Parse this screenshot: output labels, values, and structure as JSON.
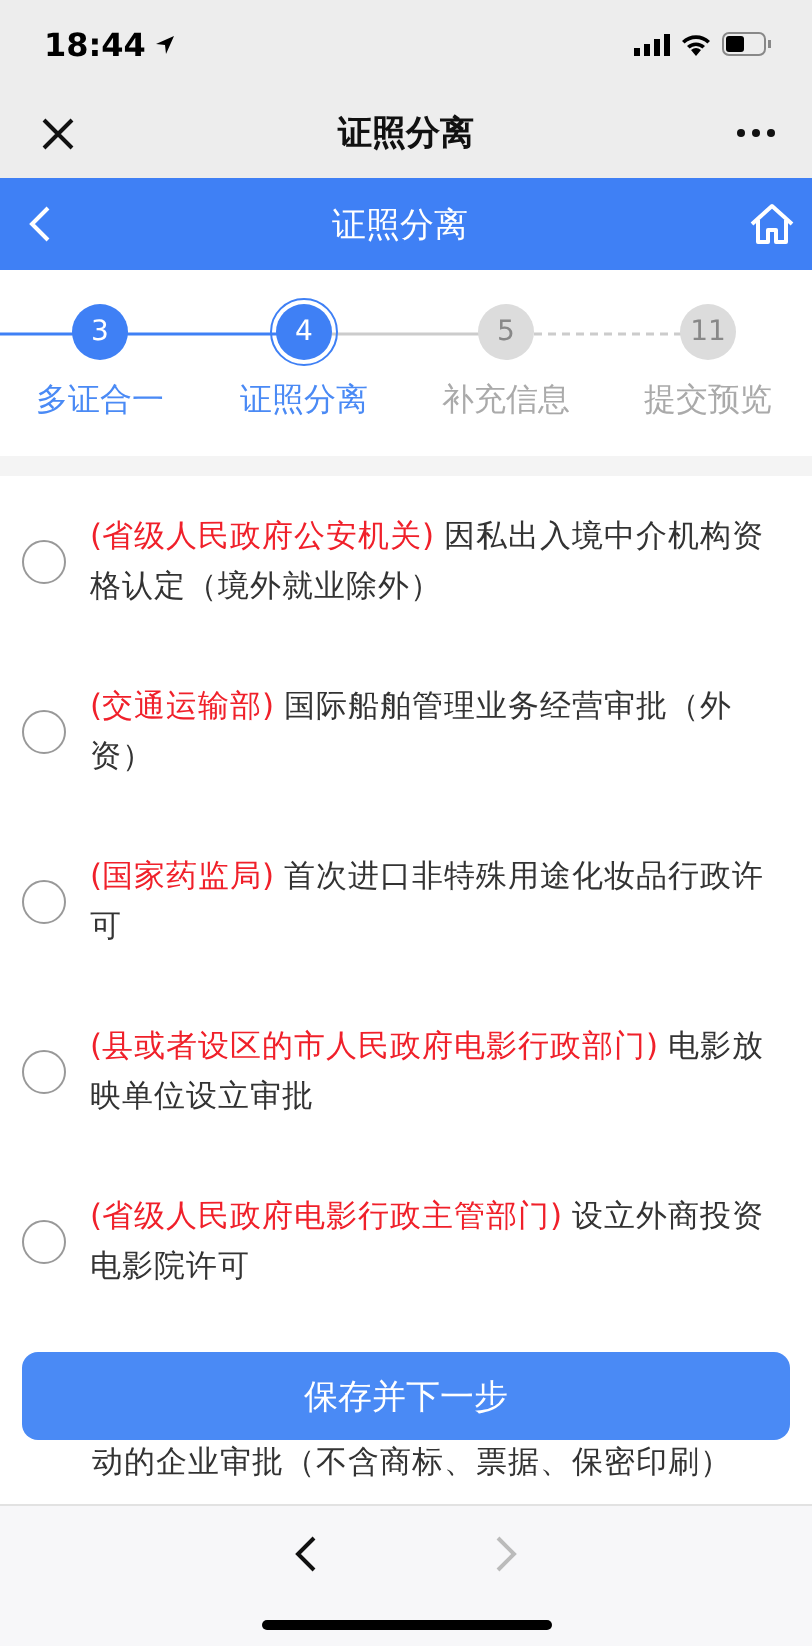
{
  "status_bar": {
    "time": "18:44"
  },
  "wechat_bar": {
    "title": "证照分离"
  },
  "header": {
    "title": "证照分离"
  },
  "steps": [
    {
      "number": "3",
      "label": "多证合一",
      "completed": true,
      "selected": false
    },
    {
      "number": "4",
      "label": "证照分离",
      "completed": true,
      "selected": true
    },
    {
      "number": "5",
      "label": "补充信息",
      "completed": false,
      "selected": false
    },
    {
      "number": "11",
      "label": "提交预览",
      "completed": false,
      "selected": false
    }
  ],
  "items": [
    {
      "authority": "(省级人民政府公安机关)",
      "text": "因私出入境中介机构资格认定（境外就业除外）",
      "selected": false
    },
    {
      "authority": "(交通运输部)",
      "text": "国际船舶管理业务经营审批（外资）",
      "selected": false
    },
    {
      "authority": "(国家药监局)",
      "text": "首次进口非特殊用途化妆品行政许可",
      "selected": false
    },
    {
      "authority": "(县或者设区的市人民政府电影行政部门)",
      "text": "电影放映单位设立审批",
      "selected": false
    },
    {
      "authority": "(省级人民政府电影行政主管部门)",
      "text": "设立外商投资电影院许可",
      "selected": false
    }
  ],
  "covered_item": {
    "text": "动的企业审批（不含商标、票据、保密印刷）"
  },
  "save_button": {
    "label": "保存并下一步"
  },
  "browser_toolbar": {
    "back_disabled": false,
    "forward_disabled": true
  }
}
